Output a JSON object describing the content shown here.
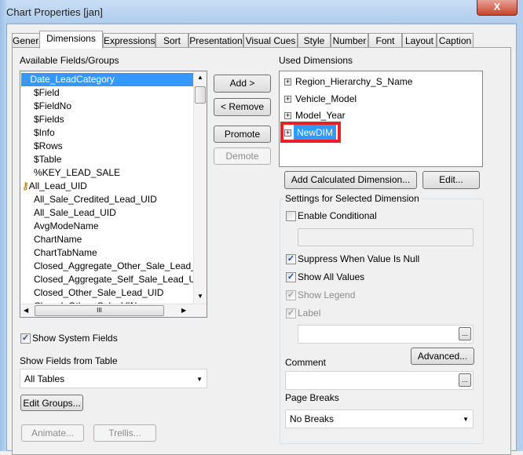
{
  "window": {
    "title": "Chart Properties [jan]",
    "close": "X"
  },
  "tabs": [
    "General",
    "Dimensions",
    "Expressions",
    "Sort",
    "Presentation",
    "Visual Cues",
    "Style",
    "Number",
    "Font",
    "Layout",
    "Caption"
  ],
  "available": {
    "label": "Available Fields/Groups",
    "items": [
      "Date_LeadCategory",
      "$Field",
      "$FieldNo",
      "$Fields",
      "$Info",
      "$Rows",
      "$Table",
      "%KEY_LEAD_SALE",
      "All_Lead_UID",
      "All_Sale_Credited_Lead_UID",
      "All_Sale_Lead_UID",
      "AvgModeName",
      "ChartName",
      "ChartTabName",
      "Closed_Aggregate_Other_Sale_Lead_UID",
      "Closed_Aggregate_Self_Sale_Lead_UID",
      "Closed_Other_Sale_Lead_UID",
      "Closed_Other_Sale_VIN"
    ],
    "selected": 0,
    "hscroll_grip": "III"
  },
  "buttons": {
    "add": "Add >",
    "remove": "< Remove",
    "promote": "Promote",
    "demote": "Demote",
    "add_calc": "Add Calculated Dimension...",
    "edit": "Edit...",
    "advanced": "Advanced...",
    "edit_groups": "Edit Groups...",
    "animate": "Animate...",
    "trellis": "Trellis...",
    "ellipsis": "..."
  },
  "used": {
    "label": "Used Dimensions",
    "items": [
      "Region_Hierarchy_S_Name",
      "Vehicle_Model",
      "Model_Year",
      "NewDIM"
    ],
    "selected": 3
  },
  "settings": {
    "legend": "Settings for Selected Dimension",
    "enable_conditional": "Enable Conditional",
    "suppress_null": "Suppress When Value Is Null",
    "show_all_values": "Show All Values",
    "show_legend": "Show Legend",
    "label": "Label",
    "comment": "Comment",
    "page_breaks": "Page Breaks",
    "page_breaks_value": "No Breaks"
  },
  "left_bottom": {
    "show_system_fields": "Show System Fields",
    "show_fields_from_table": "Show Fields from Table",
    "table_value": "All Tables"
  },
  "colors": {
    "selection": "#3399ff",
    "highlight_box": "#e8202a"
  }
}
